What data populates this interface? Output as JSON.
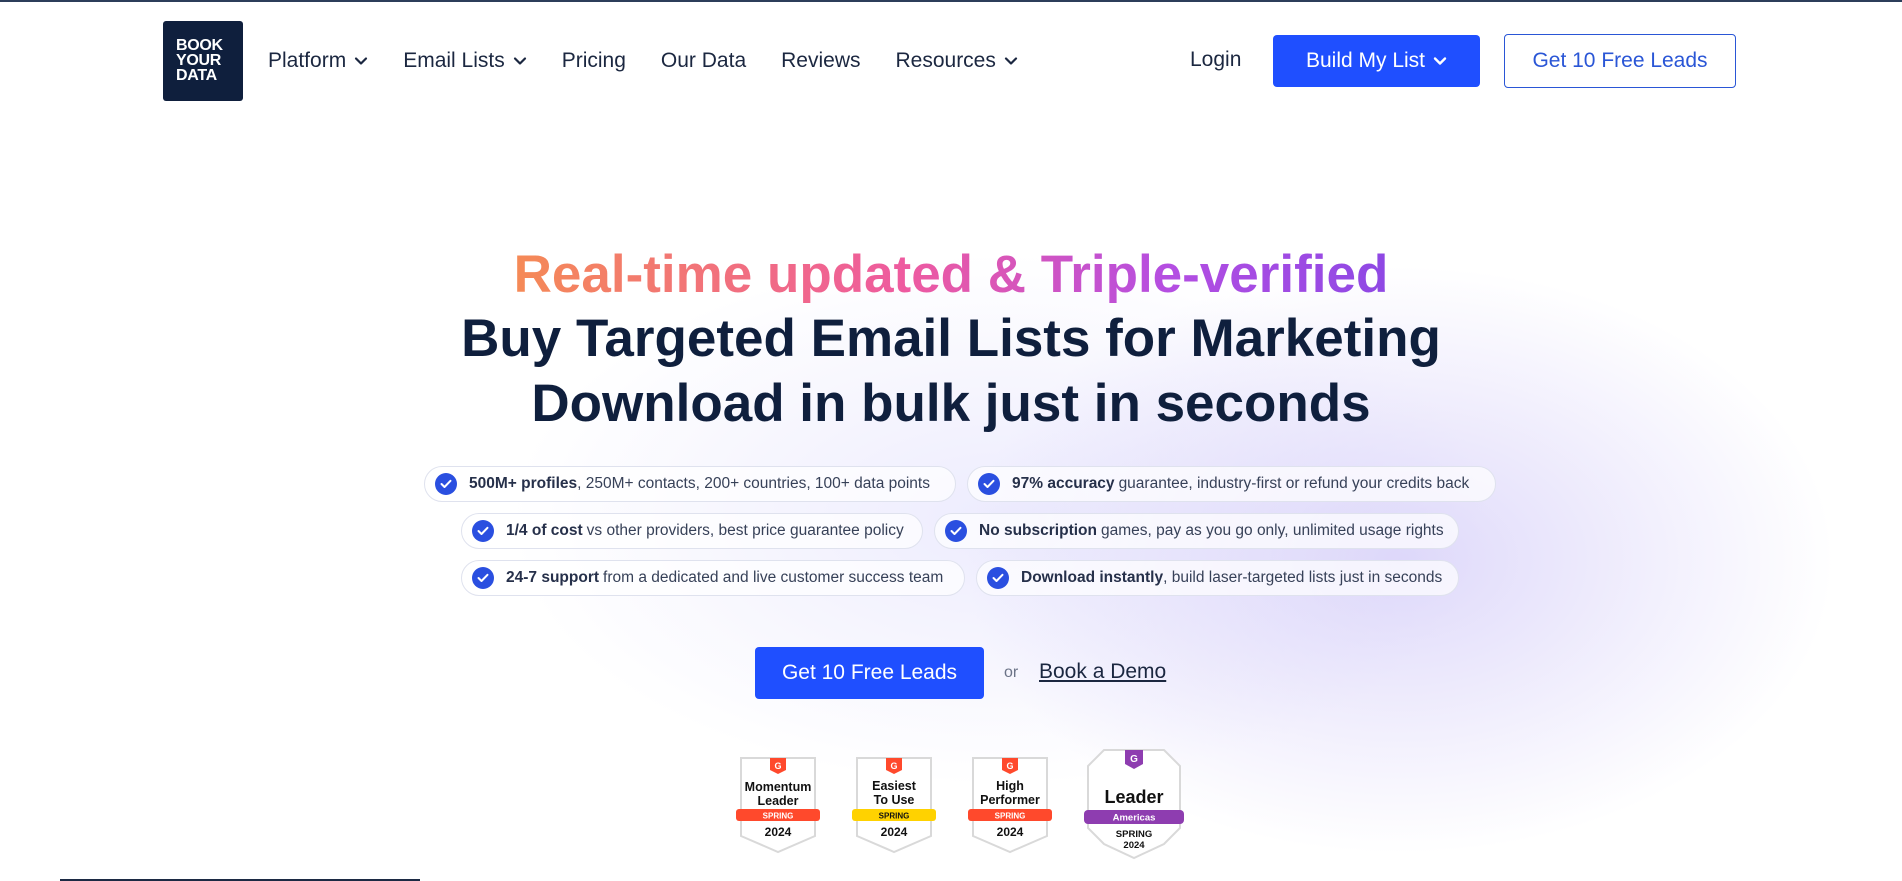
{
  "brand": {
    "logo_lines": [
      "BOOK",
      "YOUR",
      "DATA"
    ]
  },
  "nav": {
    "items": [
      {
        "label": "Platform",
        "has_dropdown": true
      },
      {
        "label": "Email Lists",
        "has_dropdown": true
      },
      {
        "label": "Pricing",
        "has_dropdown": false
      },
      {
        "label": "Our Data",
        "has_dropdown": false
      },
      {
        "label": "Reviews",
        "has_dropdown": false
      },
      {
        "label": "Resources",
        "has_dropdown": true
      }
    ],
    "login": "Login",
    "build_button": "Build My List",
    "free_leads_button": "Get 10 Free Leads"
  },
  "hero": {
    "gradient_title": "Real-time updated & Triple-verified",
    "title_line2": "Buy Targeted Email Lists for Marketing",
    "title_line3": "Download in bulk just in seconds"
  },
  "features": [
    {
      "bold": "500M+ profiles",
      "rest": ", 250M+ contacts, 200+ countries, 100+ data points"
    },
    {
      "bold": "97% accuracy",
      "rest": "guarantee, industry-first or refund your credits back"
    },
    {
      "bold": "1/4 of cost",
      "rest": "vs other providers, best price guarantee policy"
    },
    {
      "bold": "No subscription",
      "rest": "games, pay as you go only, unlimited usage rights"
    },
    {
      "bold": "24-7 support",
      "rest": "from a dedicated and live customer success team"
    },
    {
      "bold": "Download instantly",
      "rest": ", build laser-targeted lists just in seconds"
    }
  ],
  "cta": {
    "primary": "Get 10 Free Leads",
    "or": "or",
    "secondary": "Book a Demo"
  },
  "badges": [
    {
      "line1": "Momentum",
      "line2": "Leader",
      "ribbon": "SPRING",
      "year": "2024",
      "ribbon_color": "#ff492c"
    },
    {
      "line1": "Easiest",
      "line2": "To Use",
      "ribbon": "SPRING",
      "year": "2024",
      "ribbon_color": "#ffd200"
    },
    {
      "line1": "High",
      "line2": "Performer",
      "ribbon": "SPRING",
      "year": "2024",
      "ribbon_color": "#ff492c"
    },
    {
      "line1": "Leader",
      "line2": "",
      "ribbon": "Americas",
      "year": "SPRING 2024",
      "ribbon_color": "#8e3db0"
    }
  ],
  "colors": {
    "primary": "#1f4fff",
    "navy": "#0f1f3d",
    "check": "#2a4fe0",
    "g2_red": "#ff492c",
    "g2_purple": "#8e3db0"
  }
}
